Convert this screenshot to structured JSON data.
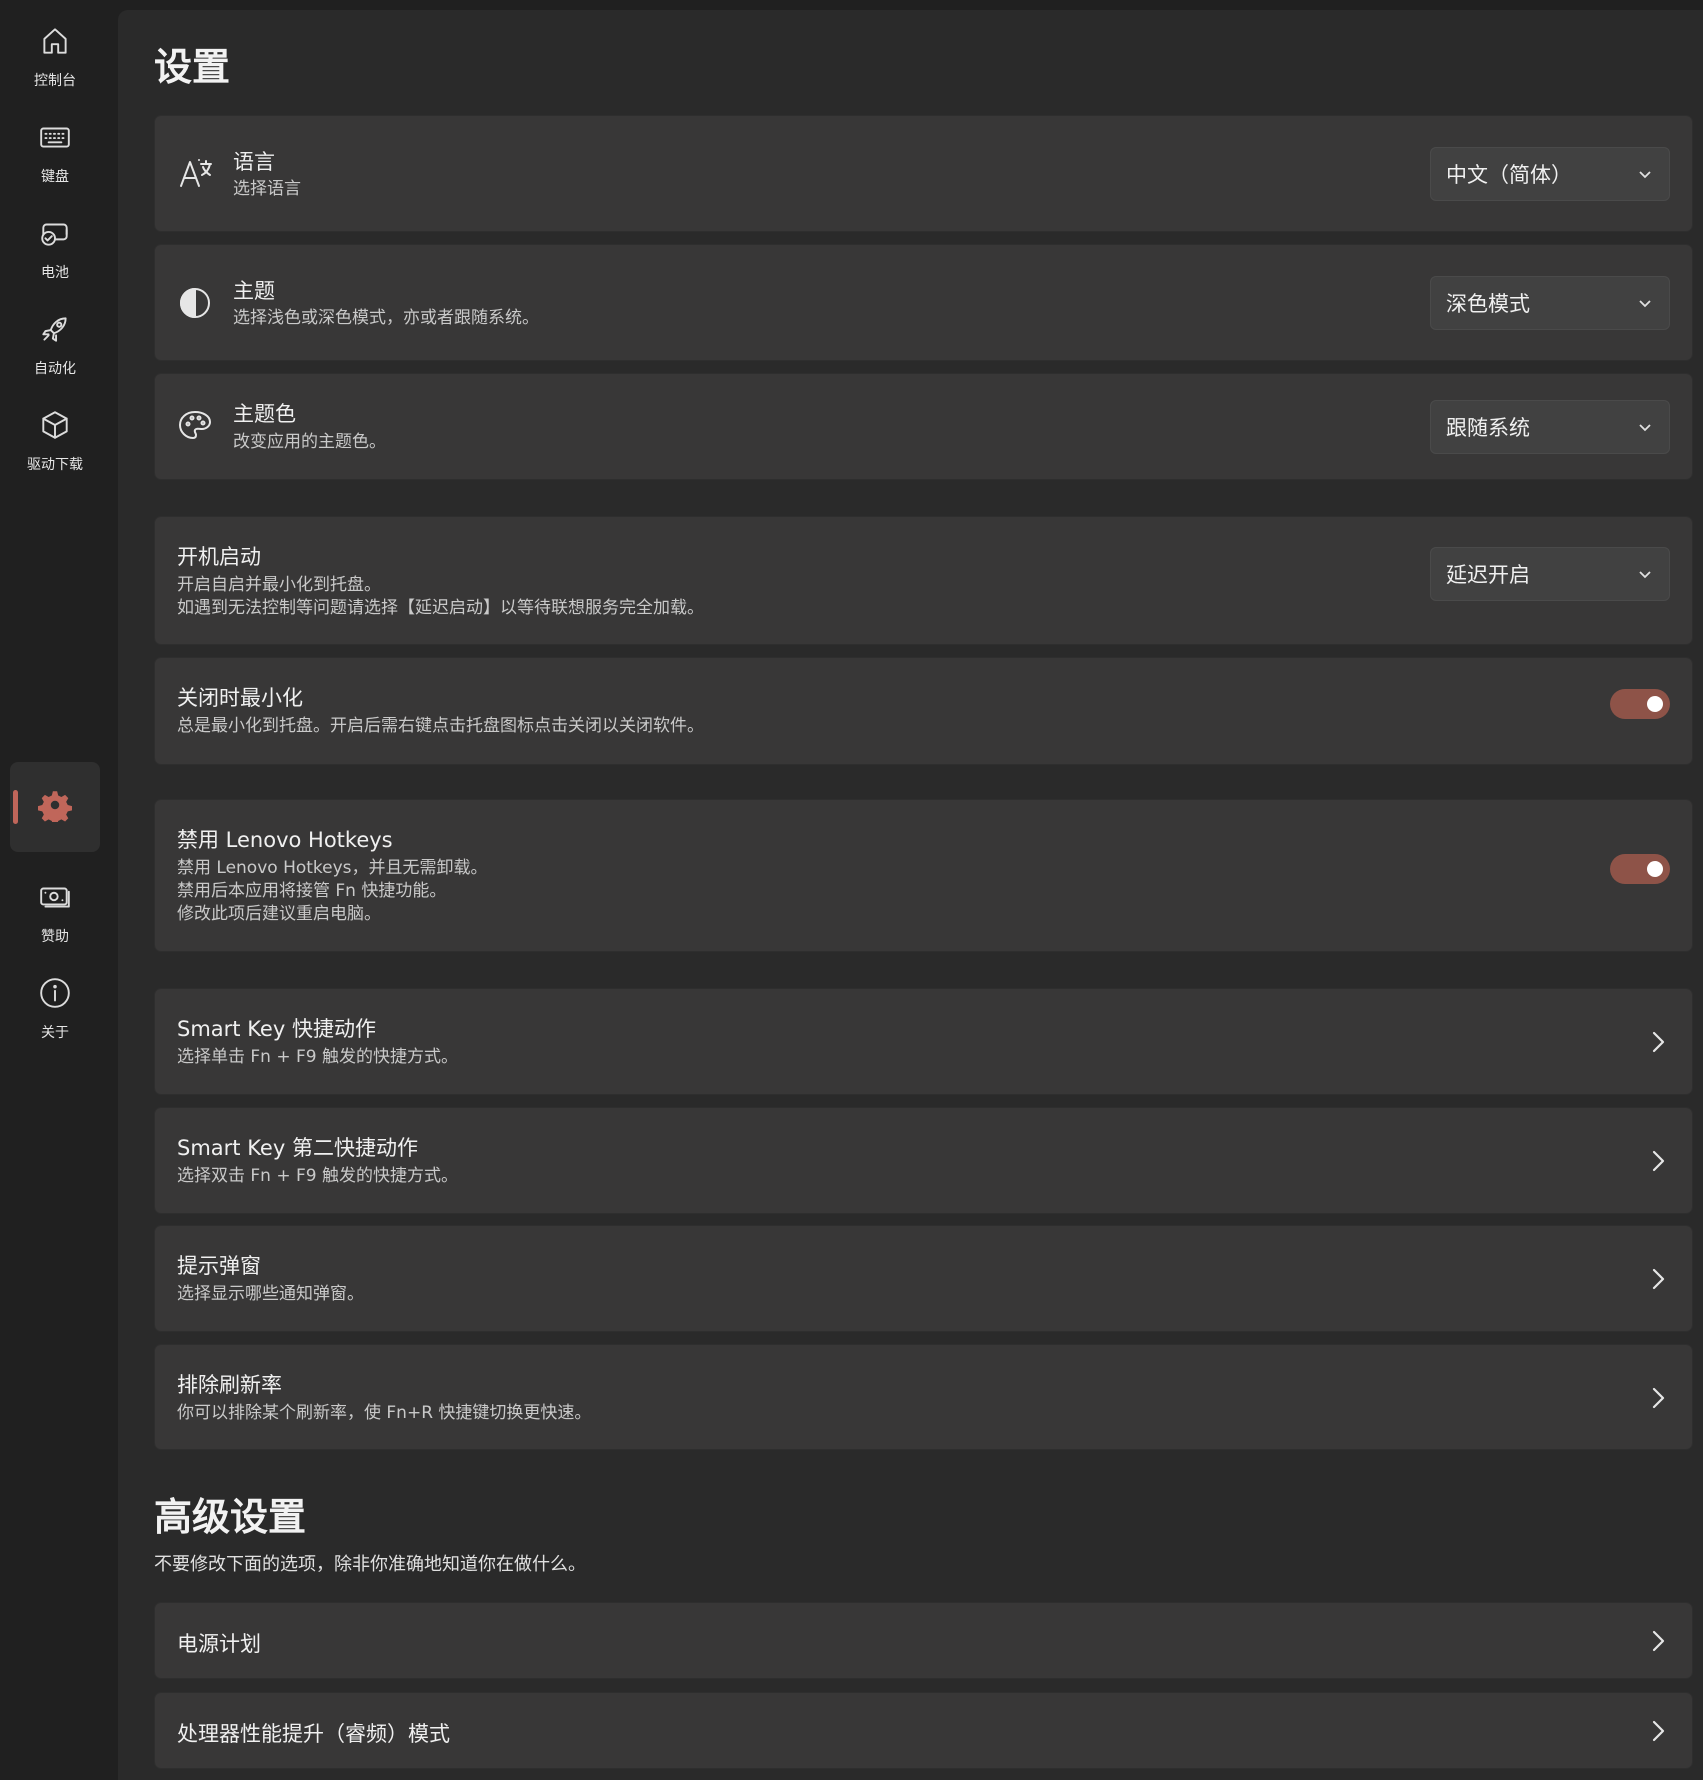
{
  "sidebar": {
    "items": [
      {
        "label": "控制台",
        "icon": "home-icon"
      },
      {
        "label": "键盘",
        "icon": "keyboard-icon"
      },
      {
        "label": "电池",
        "icon": "battery-icon"
      },
      {
        "label": "自动化",
        "icon": "rocket-icon"
      },
      {
        "label": "驱动下载",
        "icon": "package-icon"
      },
      {
        "label": "",
        "icon": "gear-icon",
        "active": true
      },
      {
        "label": "赞助",
        "icon": "money-icon"
      },
      {
        "label": "关于",
        "icon": "info-icon"
      }
    ],
    "accent_color": "#c0665a"
  },
  "page": {
    "title": "设置"
  },
  "settings": {
    "language": {
      "title": "语言",
      "desc": "选择语言",
      "value": "中文（简体）",
      "icon": "language-icon"
    },
    "theme": {
      "title": "主题",
      "desc": "选择浅色或深色模式，亦或者跟随系统。",
      "value": "深色模式",
      "icon": "contrast-icon"
    },
    "accent": {
      "title": "主题色",
      "desc": "改变应用的主题色。",
      "value": "跟随系统",
      "icon": "palette-icon"
    },
    "autostart": {
      "title": "开机启动",
      "desc": "开启自启并最小化到托盘。\n如遇到无法控制等问题请选择【延迟启动】以等待联想服务完全加载。",
      "value": "延迟开启"
    },
    "minimize_on_close": {
      "title": "关闭时最小化",
      "desc": "总是最小化到托盘。开启后需右键点击托盘图标点击关闭以关闭软件。",
      "enabled": true
    },
    "disable_hotkeys": {
      "title": "禁用 Lenovo Hotkeys",
      "desc": "禁用 Lenovo Hotkeys，并且无需卸载。\n禁用后本应用将接管 Fn 快捷功能。\n修改此项后建议重启电脑。",
      "enabled": true
    },
    "smart_key": {
      "title": "Smart Key 快捷动作",
      "desc": "选择单击 Fn + F9 触发的快捷方式。"
    },
    "smart_key_2": {
      "title": "Smart Key 第二快捷动作",
      "desc": "选择双击 Fn + F9 触发的快捷方式。"
    },
    "notifications": {
      "title": "提示弹窗",
      "desc": "选择显示哪些通知弹窗。"
    },
    "refresh_exclude": {
      "title": "排除刷新率",
      "desc": "你可以排除某个刷新率，使 Fn+R 快捷键切换更快速。"
    }
  },
  "advanced": {
    "title": "高级设置",
    "desc": "不要修改下面的选项，除非你准确地知道你在做什么。",
    "power_plan": {
      "title": "电源计划"
    },
    "cpu_boost": {
      "title": "处理器性能提升（睿频）模式"
    }
  },
  "toggle_color": "#8e5348"
}
